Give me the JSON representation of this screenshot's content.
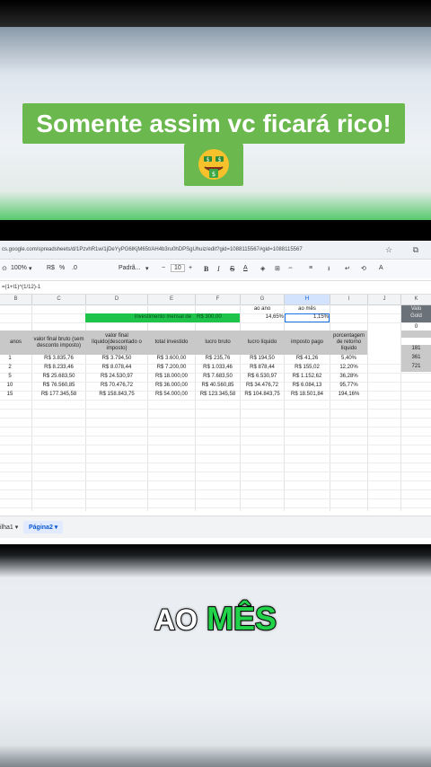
{
  "hero": {
    "title": "Somente assim vc ficará rico!",
    "emoji_icon": "money-mouth-face"
  },
  "browser": {
    "url": "cs.google.com/spreadsheets/d/1PzvhR1w/1jDeYyPG6lKjM65t/AH4b3ru0hDPSgUhuiz/edit?gid=1088115567#gid=1088115567"
  },
  "toolbar": {
    "zoom": "100%",
    "currency": "R$",
    "percent": "%",
    "decimal": ".0",
    "format": "Padrã...",
    "font_size": "10",
    "bold": "B",
    "italic": "I",
    "strike": "S",
    "text_color": "A"
  },
  "formula": "=(1+I1)^(1/12)-1",
  "columns": [
    "B",
    "C",
    "D",
    "E",
    "F",
    "G",
    "H",
    "I",
    "J",
    "K"
  ],
  "top_rows": {
    "investment_label": "investimento mensal de",
    "investment_value": "R$ 300,00",
    "ao_ano_label": "ao ano",
    "ao_mes_label": "ao mês",
    "ao_ano_value": "14,65%",
    "ao_mes_value": "1,15%"
  },
  "table": {
    "headers": [
      "anos",
      "valor final bruto (sem desconto imposto)",
      "valor final líquido(descontado o imposto)",
      "total investido",
      "lucro bruto",
      "lucro líquido",
      "imposto pago",
      "porcentagem de retorno líquido"
    ],
    "rows": [
      [
        "1",
        "R$ 3.835,76",
        "R$ 3.794,50",
        "R$ 3.600,00",
        "R$ 235,76",
        "R$ 194,50",
        "R$ 41,26",
        "5,40%"
      ],
      [
        "2",
        "R$ 8.233,46",
        "R$ 8.078,44",
        "R$ 7.200,00",
        "R$ 1.033,46",
        "R$ 878,44",
        "R$ 155,02",
        "12,20%"
      ],
      [
        "5",
        "R$ 25.683,50",
        "R$ 24.530,97",
        "R$ 18.000,00",
        "R$ 7.683,50",
        "R$ 6.530,97",
        "R$ 1.152,62",
        "36,28%"
      ],
      [
        "10",
        "R$ 76.560,85",
        "R$ 70.476,72",
        "R$ 36.000,00",
        "R$ 40.560,85",
        "R$ 34.476,72",
        "R$ 6.084,13",
        "95,77%"
      ],
      [
        "15",
        "R$ 177.345,58",
        "R$ 158.843,75",
        "R$ 54.000,00",
        "R$ 123.345,58",
        "R$ 104.843,75",
        "R$ 18.501,84",
        "194,16%"
      ]
    ]
  },
  "side_values": [
    "Valo",
    "Gold",
    "0",
    "181",
    "361",
    "721"
  ],
  "tabs": [
    "ilha1",
    "Página2"
  ],
  "caption": {
    "word1": "AO",
    "word2": "MÊS"
  }
}
